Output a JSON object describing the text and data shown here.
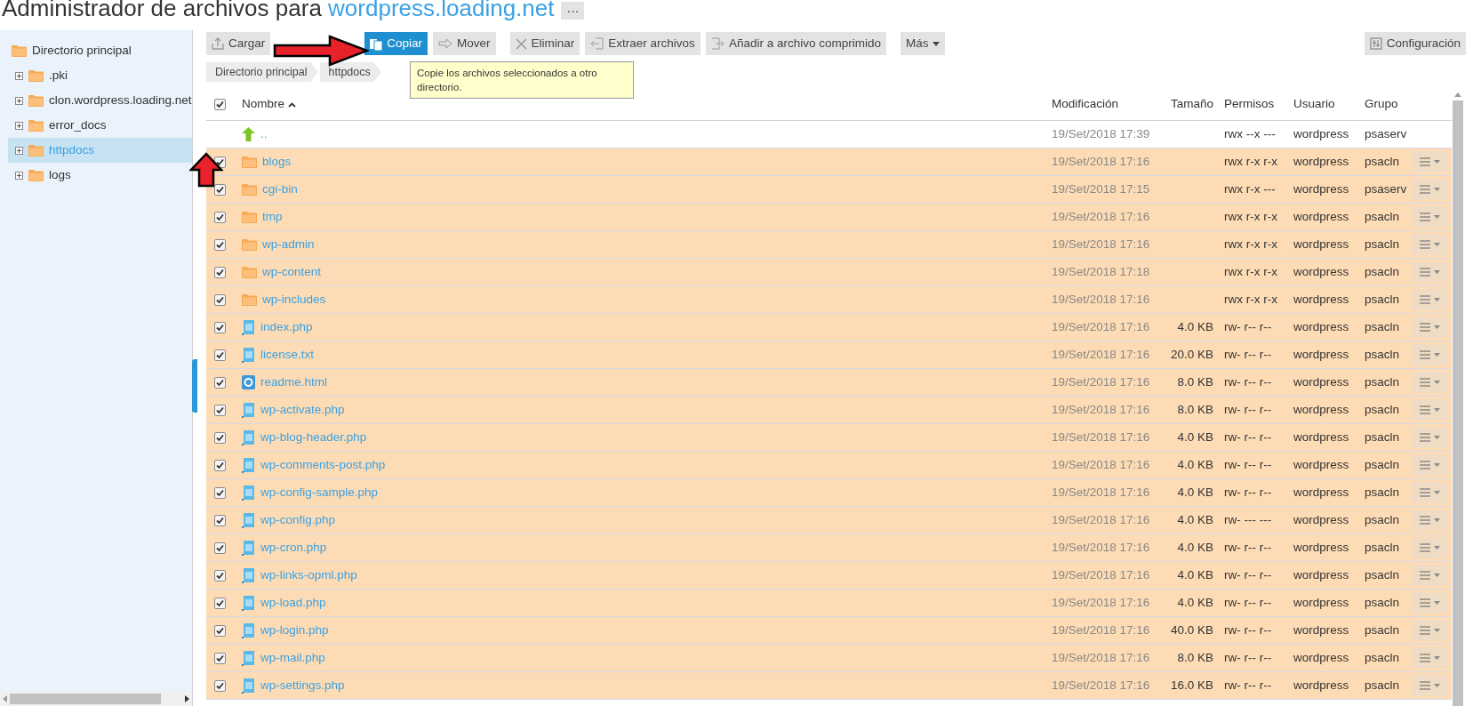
{
  "title": {
    "prefix": "Administrador de archivos para",
    "domain": "wordpress.loading.net",
    "more": "···"
  },
  "sidebar": {
    "tree": [
      {
        "label": "Directorio principal",
        "selected": false,
        "children": [
          {
            "label": ".pki",
            "expanded": false,
            "selected": false
          },
          {
            "label": "clon.wordpress.loading.net",
            "expanded": false,
            "selected": false
          },
          {
            "label": "error_docs",
            "expanded": false,
            "selected": false
          },
          {
            "label": "httpdocs",
            "expanded": false,
            "selected": true
          },
          {
            "label": "logs",
            "expanded": false,
            "selected": false
          }
        ]
      }
    ]
  },
  "toolbar": {
    "buttons": [
      {
        "label": "Cargar",
        "kind": "upload",
        "active": false
      },
      {
        "label": "Copiar",
        "kind": "copy",
        "active": true
      },
      {
        "label": "Mover",
        "kind": "move",
        "active": false
      },
      {
        "label": "Eliminar",
        "kind": "delete",
        "active": false
      },
      {
        "label": "Extraer archivos",
        "kind": "extract",
        "active": false
      },
      {
        "label": "Añadir a archivo comprimido",
        "kind": "archive",
        "active": false
      },
      {
        "label": "Más",
        "kind": "menu",
        "active": false
      }
    ],
    "settings": "Configuración"
  },
  "breadcrumb": [
    "Directorio principal",
    "httpdocs"
  ],
  "tooltip": "Copie los archivos seleccionados a otro directorio.",
  "table": {
    "header_checked": true,
    "columns": [
      "Nombre",
      "Modificación",
      "Tamaño",
      "Permisos",
      "Usuario",
      "Grupo"
    ],
    "rows": [
      {
        "kind": "parent",
        "name": "..",
        "modified": "19/Set/2018 17:39",
        "size": "",
        "perms": "rwx --x ---",
        "user": "wordpress",
        "group": "psaserv",
        "selected": false
      },
      {
        "kind": "folder",
        "name": "blogs",
        "modified": "19/Set/2018 17:16",
        "size": "",
        "perms": "rwx r-x r-x",
        "user": "wordpress",
        "group": "psacln",
        "selected": true
      },
      {
        "kind": "folder",
        "name": "cgi-bin",
        "modified": "19/Set/2018 17:15",
        "size": "",
        "perms": "rwx r-x ---",
        "user": "wordpress",
        "group": "psaserv",
        "selected": true
      },
      {
        "kind": "folder",
        "name": "tmp",
        "modified": "19/Set/2018 17:16",
        "size": "",
        "perms": "rwx r-x r-x",
        "user": "wordpress",
        "group": "psacln",
        "selected": true
      },
      {
        "kind": "folder",
        "name": "wp-admin",
        "modified": "19/Set/2018 17:16",
        "size": "",
        "perms": "rwx r-x r-x",
        "user": "wordpress",
        "group": "psacln",
        "selected": true
      },
      {
        "kind": "folder",
        "name": "wp-content",
        "modified": "19/Set/2018 17:18",
        "size": "",
        "perms": "rwx r-x r-x",
        "user": "wordpress",
        "group": "psacln",
        "selected": true
      },
      {
        "kind": "folder",
        "name": "wp-includes",
        "modified": "19/Set/2018 17:16",
        "size": "",
        "perms": "rwx r-x r-x",
        "user": "wordpress",
        "group": "psacln",
        "selected": true
      },
      {
        "kind": "file",
        "name": "index.php",
        "modified": "19/Set/2018 17:16",
        "size": "4.0 KB",
        "perms": "rw- r-- r--",
        "user": "wordpress",
        "group": "psacln",
        "selected": true
      },
      {
        "kind": "file",
        "name": "license.txt",
        "modified": "19/Set/2018 17:16",
        "size": "20.0 KB",
        "perms": "rw- r-- r--",
        "user": "wordpress",
        "group": "psacln",
        "selected": true
      },
      {
        "kind": "html",
        "name": "readme.html",
        "modified": "19/Set/2018 17:16",
        "size": "8.0 KB",
        "perms": "rw- r-- r--",
        "user": "wordpress",
        "group": "psacln",
        "selected": true
      },
      {
        "kind": "file",
        "name": "wp-activate.php",
        "modified": "19/Set/2018 17:16",
        "size": "8.0 KB",
        "perms": "rw- r-- r--",
        "user": "wordpress",
        "group": "psacln",
        "selected": true
      },
      {
        "kind": "file",
        "name": "wp-blog-header.php",
        "modified": "19/Set/2018 17:16",
        "size": "4.0 KB",
        "perms": "rw- r-- r--",
        "user": "wordpress",
        "group": "psacln",
        "selected": true
      },
      {
        "kind": "file",
        "name": "wp-comments-post.php",
        "modified": "19/Set/2018 17:16",
        "size": "4.0 KB",
        "perms": "rw- r-- r--",
        "user": "wordpress",
        "group": "psacln",
        "selected": true
      },
      {
        "kind": "file",
        "name": "wp-config-sample.php",
        "modified": "19/Set/2018 17:16",
        "size": "4.0 KB",
        "perms": "rw- r-- r--",
        "user": "wordpress",
        "group": "psacln",
        "selected": true
      },
      {
        "kind": "file",
        "name": "wp-config.php",
        "modified": "19/Set/2018 17:16",
        "size": "4.0 KB",
        "perms": "rw- --- ---",
        "user": "wordpress",
        "group": "psacln",
        "selected": true
      },
      {
        "kind": "file",
        "name": "wp-cron.php",
        "modified": "19/Set/2018 17:16",
        "size": "4.0 KB",
        "perms": "rw- r-- r--",
        "user": "wordpress",
        "group": "psacln",
        "selected": true
      },
      {
        "kind": "file",
        "name": "wp-links-opml.php",
        "modified": "19/Set/2018 17:16",
        "size": "4.0 KB",
        "perms": "rw- r-- r--",
        "user": "wordpress",
        "group": "psacln",
        "selected": true
      },
      {
        "kind": "file",
        "name": "wp-load.php",
        "modified": "19/Set/2018 17:16",
        "size": "4.0 KB",
        "perms": "rw- r-- r--",
        "user": "wordpress",
        "group": "psacln",
        "selected": true
      },
      {
        "kind": "file",
        "name": "wp-login.php",
        "modified": "19/Set/2018 17:16",
        "size": "40.0 KB",
        "perms": "rw- r-- r--",
        "user": "wordpress",
        "group": "psacln",
        "selected": true
      },
      {
        "kind": "file",
        "name": "wp-mail.php",
        "modified": "19/Set/2018 17:16",
        "size": "8.0 KB",
        "perms": "rw- r-- r--",
        "user": "wordpress",
        "group": "psacln",
        "selected": true
      },
      {
        "kind": "file",
        "name": "wp-settings.php",
        "modified": "19/Set/2018 17:16",
        "size": "16.0 KB",
        "perms": "rw- r-- r--",
        "user": "wordpress",
        "group": "psacln",
        "selected": true
      }
    ]
  }
}
